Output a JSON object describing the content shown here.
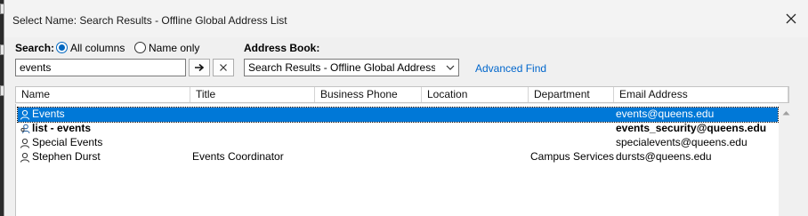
{
  "window": {
    "title": "Select Name: Search Results - Offline Global Address List"
  },
  "search": {
    "label": "Search:",
    "option_all": "All columns",
    "option_name": "Name only",
    "value": "events"
  },
  "address_book": {
    "label": "Address Book:",
    "selected": "Search Results - Offline Global Address List"
  },
  "advanced_find": "Advanced Find",
  "columns": [
    "Name",
    "Title",
    "Business Phone",
    "Location",
    "Department",
    "Email Address"
  ],
  "rows": [
    {
      "name": "Events",
      "title": "",
      "phone": "",
      "location": "",
      "department": "",
      "email": "events@queens.edu",
      "icon": "person-icon",
      "selected": true,
      "bold": false
    },
    {
      "name": "list - events",
      "title": "",
      "phone": "",
      "location": "",
      "department": "",
      "email": "events_security@queens.edu",
      "icon": "group-icon",
      "selected": false,
      "bold": true
    },
    {
      "name": "Special Events",
      "title": "",
      "phone": "",
      "location": "",
      "department": "",
      "email": "specialevents@queens.edu",
      "icon": "person-icon",
      "selected": false,
      "bold": false
    },
    {
      "name": "Stephen Durst",
      "title": "Events Coordinator",
      "phone": "",
      "location": "",
      "department": "Campus Services",
      "email": "dursts@queens.edu",
      "icon": "person-icon",
      "selected": false,
      "bold": false
    }
  ],
  "colors": {
    "selection": "#0078d7",
    "link": "#0066cc",
    "radio_accent": "#0067c0"
  }
}
